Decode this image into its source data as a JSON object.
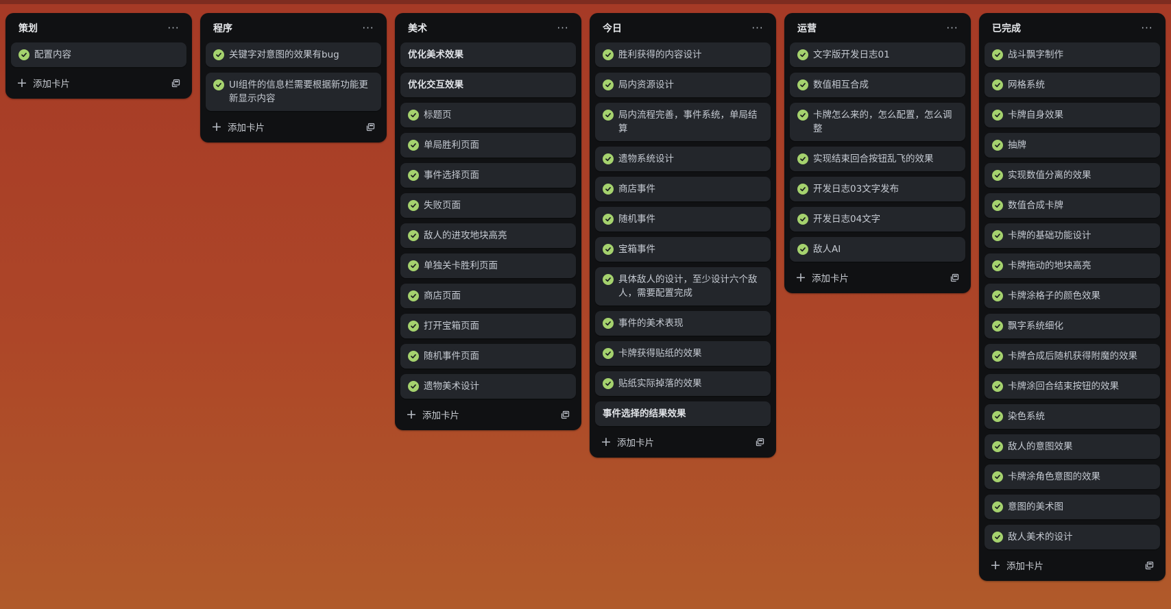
{
  "lists": [
    {
      "title": "策划",
      "cards": [
        {
          "text": "配置内容",
          "done": true
        }
      ],
      "add_label": "添加卡片"
    },
    {
      "title": "程序",
      "cards": [
        {
          "text": "关键字对意图的效果有bug",
          "done": true
        },
        {
          "text": "UI组件的信息栏需要根据新功能更新显示内容",
          "done": true
        }
      ],
      "add_label": "添加卡片"
    },
    {
      "title": "美术",
      "cards": [
        {
          "text": "优化美术效果",
          "done": false
        },
        {
          "text": "优化交互效果",
          "done": false
        },
        {
          "text": "标题页",
          "done": true
        },
        {
          "text": "单局胜利页面",
          "done": true
        },
        {
          "text": "事件选择页面",
          "done": true
        },
        {
          "text": "失败页面",
          "done": true
        },
        {
          "text": "敌人的进攻地块高亮",
          "done": true
        },
        {
          "text": "单独关卡胜利页面",
          "done": true
        },
        {
          "text": "商店页面",
          "done": true
        },
        {
          "text": "打开宝箱页面",
          "done": true
        },
        {
          "text": "随机事件页面",
          "done": true
        },
        {
          "text": "遗物美术设计",
          "done": true
        }
      ],
      "add_label": "添加卡片"
    },
    {
      "title": "今日",
      "cards": [
        {
          "text": "胜利获得的内容设计",
          "done": true
        },
        {
          "text": "局内资源设计",
          "done": true
        },
        {
          "text": "局内流程完善，事件系统，单局结算",
          "done": true
        },
        {
          "text": "遗物系统设计",
          "done": true
        },
        {
          "text": "商店事件",
          "done": true
        },
        {
          "text": "随机事件",
          "done": true
        },
        {
          "text": "宝箱事件",
          "done": true
        },
        {
          "text": "具体敌人的设计，至少设计六个敌人，需要配置完成",
          "done": true
        },
        {
          "text": "事件的美术表现",
          "done": true
        },
        {
          "text": "卡牌获得贴纸的效果",
          "done": true
        },
        {
          "text": "贴纸实际掉落的效果",
          "done": true
        },
        {
          "text": "事件选择的结果效果",
          "done": false
        }
      ],
      "add_label": "添加卡片"
    },
    {
      "title": "运营",
      "cards": [
        {
          "text": "文字版开发日志01",
          "done": true
        },
        {
          "text": "数值相互合成",
          "done": true
        },
        {
          "text": "卡牌怎么来的，怎么配置，怎么调整",
          "done": true
        },
        {
          "text": "实现结束回合按钮乱飞的效果",
          "done": true
        },
        {
          "text": "开发日志03文字发布",
          "done": true
        },
        {
          "text": "开发日志04文字",
          "done": true
        },
        {
          "text": "敌人AI",
          "done": true
        }
      ],
      "add_label": "添加卡片"
    },
    {
      "title": "已完成",
      "cards": [
        {
          "text": "战斗飘字制作",
          "done": true
        },
        {
          "text": "网格系统",
          "done": true
        },
        {
          "text": "卡牌自身效果",
          "done": true
        },
        {
          "text": "抽牌",
          "done": true
        },
        {
          "text": "实现数值分离的效果",
          "done": true
        },
        {
          "text": "数值合成卡牌",
          "done": true
        },
        {
          "text": "卡牌的基础功能设计",
          "done": true
        },
        {
          "text": "卡牌拖动的地块高亮",
          "done": true
        },
        {
          "text": "卡牌涂格子的颜色效果",
          "done": true
        },
        {
          "text": "飘字系统细化",
          "done": true
        },
        {
          "text": "卡牌合成后随机获得附魔的效果",
          "done": true
        },
        {
          "text": "卡牌涂回合结束按钮的效果",
          "done": true
        },
        {
          "text": "染色系统",
          "done": true
        },
        {
          "text": "敌人的意图效果",
          "done": true
        },
        {
          "text": "卡牌涂角色意图的效果",
          "done": true
        },
        {
          "text": "意图的美术图",
          "done": true
        },
        {
          "text": "敌人美术的设计",
          "done": true
        }
      ],
      "add_label": "添加卡片"
    }
  ],
  "icons": {
    "check": "check-circle-icon",
    "menu": "more-horizontal-icon",
    "add": "plus-icon",
    "template": "card-template-icon"
  },
  "colors": {
    "list_bg": "#101113",
    "card_bg": "#23262b",
    "check_green": "#a5d26e",
    "board_bg": "#a63a26"
  }
}
